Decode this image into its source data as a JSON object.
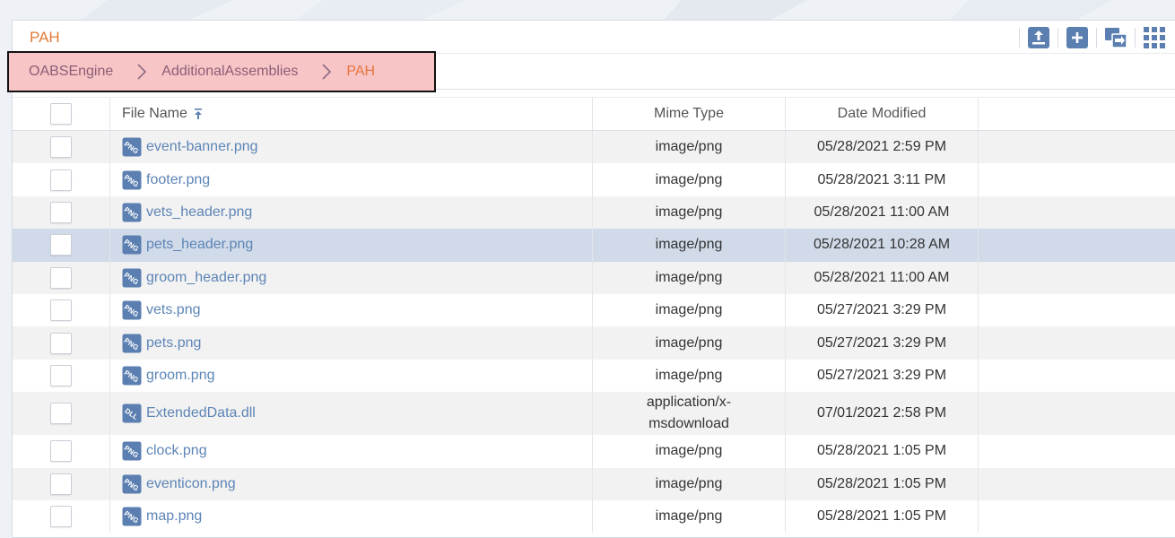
{
  "folder_title": "PAH",
  "toolbar": {
    "upload_icon": "upload-icon",
    "add_icon": "add-icon",
    "move_icon": "move-icon",
    "view_icon": "grid-view-icon"
  },
  "breadcrumb": [
    {
      "label": "OABSEngine"
    },
    {
      "label": "AdditionalAssemblies"
    },
    {
      "label": "PAH"
    }
  ],
  "columns": {
    "name": "File Name",
    "mime": "Mime Type",
    "date": "Date Modified"
  },
  "files": [
    {
      "name": "event-banner.png",
      "type_badge": "PNG",
      "mime": "image/png",
      "date": "05/28/2021 2:59 PM"
    },
    {
      "name": "footer.png",
      "type_badge": "PNG",
      "mime": "image/png",
      "date": "05/28/2021 3:11 PM"
    },
    {
      "name": "vets_header.png",
      "type_badge": "PNG",
      "mime": "image/png",
      "date": "05/28/2021 11:00 AM"
    },
    {
      "name": "pets_header.png",
      "type_badge": "PNG",
      "mime": "image/png",
      "date": "05/28/2021 10:28 AM"
    },
    {
      "name": "groom_header.png",
      "type_badge": "PNG",
      "mime": "image/png",
      "date": "05/28/2021 11:00 AM"
    },
    {
      "name": "vets.png",
      "type_badge": "PNG",
      "mime": "image/png",
      "date": "05/27/2021 3:29 PM"
    },
    {
      "name": "pets.png",
      "type_badge": "PNG",
      "mime": "image/png",
      "date": "05/27/2021 3:29 PM"
    },
    {
      "name": "groom.png",
      "type_badge": "PNG",
      "mime": "image/png",
      "date": "05/27/2021 3:29 PM"
    },
    {
      "name": "ExtendedData.dll",
      "type_badge": "DLL",
      "mime_lines": [
        "application/x-",
        "msdownload"
      ],
      "date": "07/01/2021 2:58 PM"
    },
    {
      "name": "clock.png",
      "type_badge": "PNG",
      "mime": "image/png",
      "date": "05/28/2021 1:05 PM"
    },
    {
      "name": "eventicon.png",
      "type_badge": "PNG",
      "mime": "image/png",
      "date": "05/28/2021 1:05 PM"
    },
    {
      "name": "map.png",
      "type_badge": "PNG",
      "mime": "image/png",
      "date": "05/28/2021 1:05 PM"
    }
  ],
  "colors": {
    "accent_orange": "#e8743f",
    "link_blue": "#5d85b6",
    "icon_blue": "#5b7fb0",
    "selected_row": "#d0dae8",
    "breadcrumb_highlight": "#f7c5c5"
  }
}
